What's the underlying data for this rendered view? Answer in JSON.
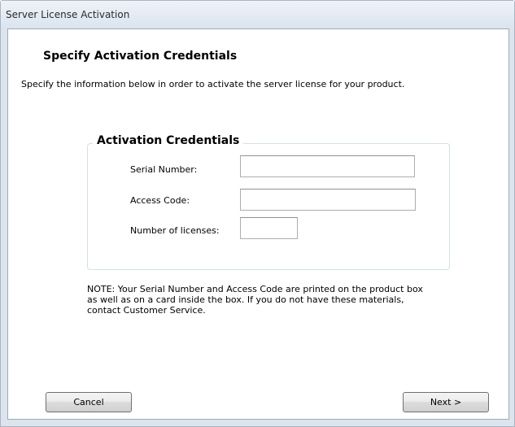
{
  "window": {
    "title": "Server License Activation"
  },
  "page": {
    "heading": "Specify Activation Credentials",
    "description": "Specify the information below in order to activate the server license for your product."
  },
  "credentials_group": {
    "label": "Activation Credentials",
    "serial_number_label": "Serial Number:",
    "serial_number_value": "",
    "access_code_label": "Access Code:",
    "access_code_value": "",
    "licenses_label": "Number of licenses:",
    "licenses_value": ""
  },
  "note": "NOTE:  Your Serial Number and Access Code are printed on the product box\nas well as on a card inside the box.  If you do not have these materials,\ncontact Customer Service.",
  "buttons": {
    "cancel": "Cancel",
    "next": "Next >"
  }
}
